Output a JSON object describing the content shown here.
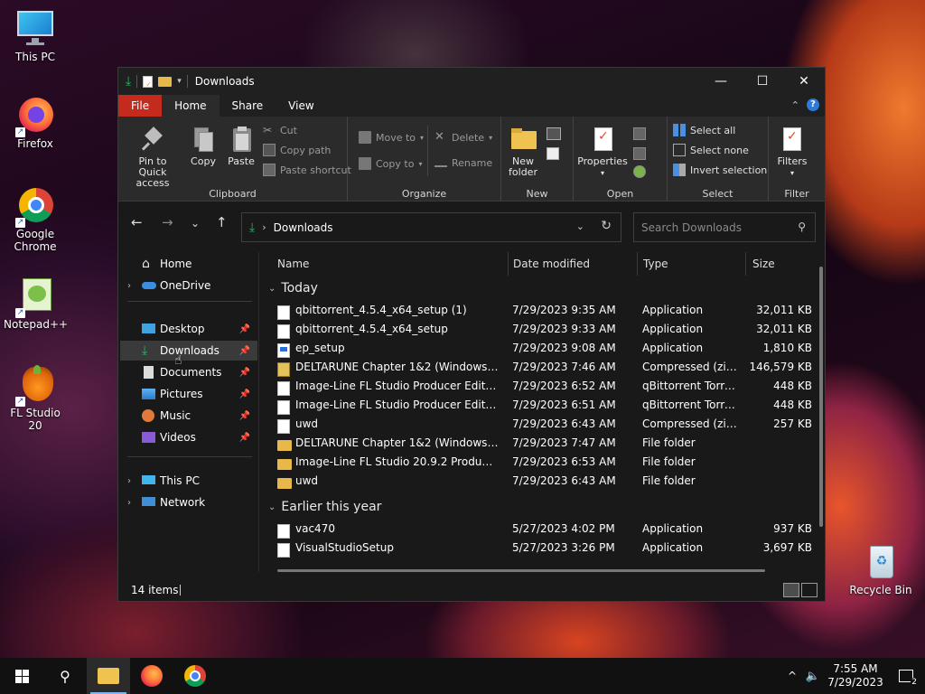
{
  "desktop": {
    "icons": [
      {
        "label": "This PC"
      },
      {
        "label": "Firefox"
      },
      {
        "label": "Google Chrome"
      },
      {
        "label": "Notepad++"
      },
      {
        "label": "FL Studio 20"
      },
      {
        "label": "Recycle Bin"
      }
    ]
  },
  "window": {
    "title": "Downloads",
    "tabs": [
      "File",
      "Home",
      "Share",
      "View"
    ],
    "ribbon": {
      "clipboard": {
        "group": "Clipboard",
        "pin": "Pin to Quick access",
        "copy": "Copy",
        "paste": "Paste",
        "cut": "Cut",
        "copy_path": "Copy path",
        "paste_shortcut": "Paste shortcut"
      },
      "organize": {
        "group": "Organize",
        "move_to": "Move to",
        "copy_to": "Copy to",
        "delete": "Delete",
        "rename": "Rename"
      },
      "new": {
        "group": "New",
        "new_folder": "New folder"
      },
      "open": {
        "group": "Open",
        "properties": "Properties"
      },
      "select": {
        "group": "Select",
        "select_all": "Select all",
        "select_none": "Select none",
        "invert": "Invert selection"
      },
      "filter": {
        "group": "Filter",
        "filters": "Filters"
      }
    },
    "address": {
      "path": "Downloads"
    },
    "search": {
      "placeholder": "Search Downloads"
    },
    "nav": [
      {
        "label": "Home"
      },
      {
        "label": "OneDrive"
      },
      {
        "label": "Desktop"
      },
      {
        "label": "Downloads"
      },
      {
        "label": "Documents"
      },
      {
        "label": "Pictures"
      },
      {
        "label": "Music"
      },
      {
        "label": "Videos"
      },
      {
        "label": "This PC"
      },
      {
        "label": "Network"
      }
    ],
    "columns": {
      "name": "Name",
      "date": "Date modified",
      "type": "Type",
      "size": "Size"
    },
    "groups": [
      {
        "label": "Today",
        "files": [
          {
            "name": "qbittorrent_4.5.4_x64_setup (1)",
            "date": "7/29/2023 9:35 AM",
            "type": "Application",
            "size": "32,011 KB",
            "icon": "doc"
          },
          {
            "name": "qbittorrent_4.5.4_x64_setup",
            "date": "7/29/2023 9:33 AM",
            "type": "Application",
            "size": "32,011 KB",
            "icon": "doc"
          },
          {
            "name": "ep_setup",
            "date": "7/29/2023 9:08 AM",
            "type": "Application",
            "size": "1,810 KB",
            "icon": "exe"
          },
          {
            "name": "DELTARUNE Chapter 1&2 (Windows 1.10)",
            "date": "7/29/2023 7:46 AM",
            "type": "Compressed (zipp...",
            "size": "146,579 KB",
            "icon": "zip"
          },
          {
            "name": "Image-Line FL Studio Producer Edition 2...",
            "date": "7/29/2023 6:52 AM",
            "type": "qBittorrent Torrent...",
            "size": "448 KB",
            "icon": "doc"
          },
          {
            "name": "Image-Line FL Studio Producer Edition 2...",
            "date": "7/29/2023 6:51 AM",
            "type": "qBittorrent Torrent...",
            "size": "448 KB",
            "icon": "doc"
          },
          {
            "name": "uwd",
            "date": "7/29/2023 6:43 AM",
            "type": "Compressed (zipp...",
            "size": "257 KB",
            "icon": "doc"
          },
          {
            "name": "DELTARUNE Chapter 1&2 (Windows 1.10)",
            "date": "7/29/2023 7:47 AM",
            "type": "File folder",
            "size": "",
            "icon": "folder"
          },
          {
            "name": "Image-Line FL Studio 20.9.2 Producer Edi...",
            "date": "7/29/2023 6:53 AM",
            "type": "File folder",
            "size": "",
            "icon": "folder"
          },
          {
            "name": "uwd",
            "date": "7/29/2023 6:43 AM",
            "type": "File folder",
            "size": "",
            "icon": "folder"
          }
        ]
      },
      {
        "label": "Earlier this year",
        "files": [
          {
            "name": "vac470",
            "date": "5/27/2023 4:02 PM",
            "type": "Application",
            "size": "937 KB",
            "icon": "doc"
          },
          {
            "name": "VisualStudioSetup",
            "date": "5/27/2023 3:26 PM",
            "type": "Application",
            "size": "3,697 KB",
            "icon": "doc"
          }
        ]
      }
    ],
    "status": {
      "count": "14 items"
    }
  },
  "taskbar": {
    "time": "7:55 AM",
    "date": "7/29/2023",
    "notifications": "2"
  },
  "colors": {
    "file_tab": "#c42b1c",
    "window_bg": "#191919",
    "ribbon_bg": "#2b2b2b",
    "accent": "#2f7ad6"
  }
}
